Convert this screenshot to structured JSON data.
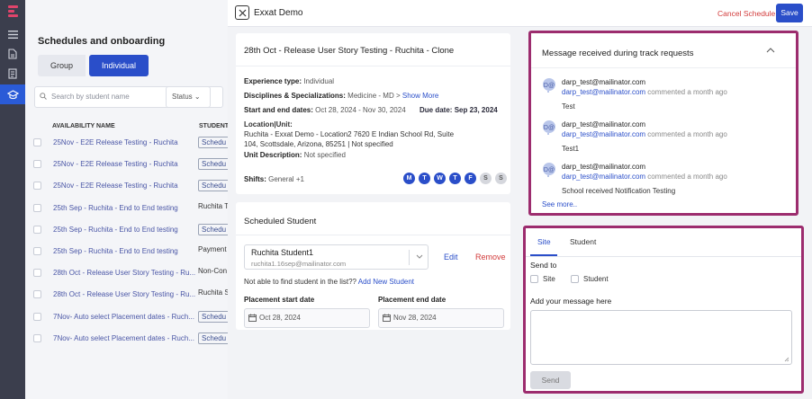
{
  "rail": {
    "logo": "exxat-logo",
    "icons": [
      "menu-icon",
      "document-icon",
      "notes-icon",
      "graduation-cap-icon"
    ],
    "accent": "#e0446b"
  },
  "background": {
    "title": "Schedules and onboarding",
    "segments": [
      "Group",
      "Individual"
    ],
    "search_placeholder": "Search by student name",
    "status_filter": "Status",
    "columns": [
      "AVAILABILITY NAME",
      "STUDENT"
    ],
    "rows": [
      {
        "name": "25Nov - E2E Release Testing - Ruchita",
        "student": "Schedu"
      },
      {
        "name": "25Nov - E2E Release Testing - Ruchita",
        "student": "Schedu"
      },
      {
        "name": "25Nov - E2E Release Testing - Ruchita",
        "student": "Schedu"
      },
      {
        "name": "25th Sep - Ruchita - End to End testing",
        "student": "Ruchita T"
      },
      {
        "name": "25th Sep - Ruchita - End to End testing",
        "student": "Schedu"
      },
      {
        "name": "25th Sep - Ruchita - End to End testing",
        "student": "Payment"
      },
      {
        "name": "28th Oct - Release User Story Testing - Ru...",
        "student": "Non-Con"
      },
      {
        "name": "28th Oct - Release User Story Testing - Ru...",
        "student": "Ruchita S"
      },
      {
        "name": "7Nov- Auto select Placement dates - Ruch...",
        "student": "Schedu"
      },
      {
        "name": "7Nov- Auto select Placement dates - Ruch...",
        "student": "Schedu"
      }
    ]
  },
  "modal": {
    "title": "Exxat Demo",
    "cancel_label": "Cancel Schedule",
    "save_label": "Save",
    "details": {
      "title": "28th Oct - Release User Story Testing - Ruchita - Clone",
      "experience_label": "Experience type:",
      "experience_value": "Individual",
      "disciplines_label": "Disciplines & Specializations:",
      "disciplines_value": "Medicine - MD",
      "show_more": "Show More",
      "dates_label": "Start and end dates:",
      "dates_value": "Oct 28, 2024 - Nov 30, 2024",
      "due_label": "Due date:",
      "due_value": "Sep 23, 2024",
      "location_label": "Location|Unit:",
      "location_value": "Ruchita - Exxat Demo - Location2 7620 E Indian School Rd, Suite 104, Scottsdale, Arizona, 85251 | Not specified",
      "unit_desc_label": "Unit Description:",
      "unit_desc_value": "Not specified",
      "shifts_label": "Shifts:",
      "shifts_value": "General",
      "shifts_extra": "+1",
      "days": [
        {
          "letter": "M",
          "active": true
        },
        {
          "letter": "T",
          "active": true
        },
        {
          "letter": "W",
          "active": true
        },
        {
          "letter": "T",
          "active": true
        },
        {
          "letter": "F",
          "active": true
        },
        {
          "letter": "S",
          "active": false
        },
        {
          "letter": "S",
          "active": false
        }
      ]
    },
    "scheduled": {
      "title": "Scheduled Student",
      "student_name": "Ruchita Student1",
      "student_email": "ruchita1.16sep@mailinator.com",
      "edit_label": "Edit",
      "remove_label": "Remove",
      "not_found_text": "Not able to find student in the list??",
      "add_new_label": "Add New Student",
      "start_label": "Placement start date",
      "start_value": "Oct 28, 2024",
      "end_label": "Placement end date",
      "end_value": "Nov 28, 2024"
    },
    "messages": {
      "title": "Message received during track requests",
      "items": [
        {
          "email": "darp_test@mailinator.com",
          "commenter": "darp_test@mailinator.com",
          "when": "commented a month ago",
          "body": "Test"
        },
        {
          "email": "darp_test@mailinator.com",
          "commenter": "darp_test@mailinator.com",
          "when": "commented a month ago",
          "body": "Test1"
        },
        {
          "email": "darp_test@mailinator.com",
          "commenter": "darp_test@mailinator.com",
          "when": "commented a month ago",
          "body": "School received Notification Testing"
        }
      ],
      "see_more": "See more.."
    },
    "compose": {
      "tabs": [
        "Site",
        "Student"
      ],
      "send_to_label": "Send to",
      "options": [
        "Site",
        "Student"
      ],
      "message_label": "Add your message here",
      "send_label": "Send"
    }
  },
  "colors": {
    "primary": "#2a4ec9",
    "danger": "#d23b3b",
    "highlight_border": "#9c2c6e"
  }
}
